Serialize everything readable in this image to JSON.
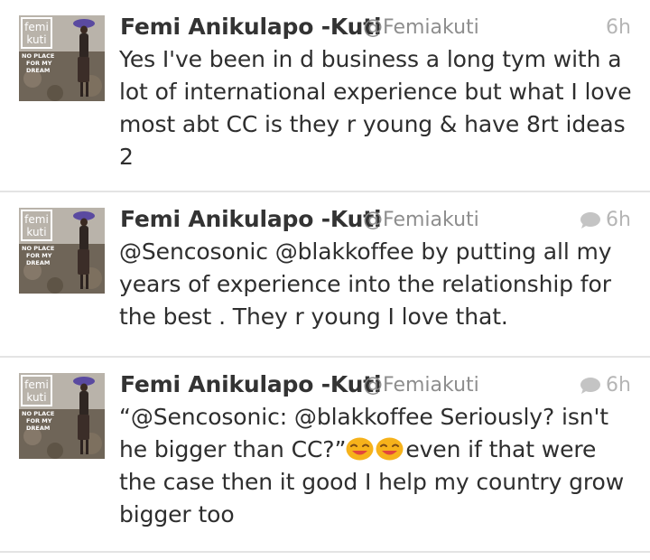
{
  "colors": {
    "name": "#333333",
    "handle": "#8e8e8e",
    "time": "#b5b5b5",
    "divider": "#e4e4e4",
    "text": "#2e2e2e",
    "emoji": "#f6b21b"
  },
  "avatar": {
    "logo_line1": "femi",
    "logo_line2": "kuti",
    "caption_line1": "NO PLACE",
    "caption_line2": "FOR MY",
    "caption_line3": "DREAM"
  },
  "tweets": [
    {
      "name": "Femi Anikulapo -Kuti",
      "handle": "@Femiakuti",
      "time": "6h",
      "has_reply_icon": false,
      "text": "Yes I've been in d business a long tym with a lot of international experience but what I love most abt CC is they r young & have 8rt ideas 2"
    },
    {
      "name": "Femi Anikulapo -Kuti",
      "handle": "@Femiakuti",
      "time": "6h",
      "has_reply_icon": true,
      "icon": "conversation-bubble-icon",
      "text": "@Sencosonic @blakkoffee by putting all my years of experience into the relationship for the best . They r young I love that."
    },
    {
      "name": "Femi Anikulapo -Kuti",
      "handle": "@Femiakuti",
      "time": "6h",
      "has_reply_icon": true,
      "icon": "conversation-bubble-icon",
      "text_before_emoji": "“@Sencosonic: @blakkoffee Seriously? isn't he bigger than CC?”",
      "emoji": [
        "smiling-face-emoji",
        "smiling-face-emoji"
      ],
      "text_after_emoji": "even if that were the case then it good I help my country grow bigger too"
    }
  ]
}
